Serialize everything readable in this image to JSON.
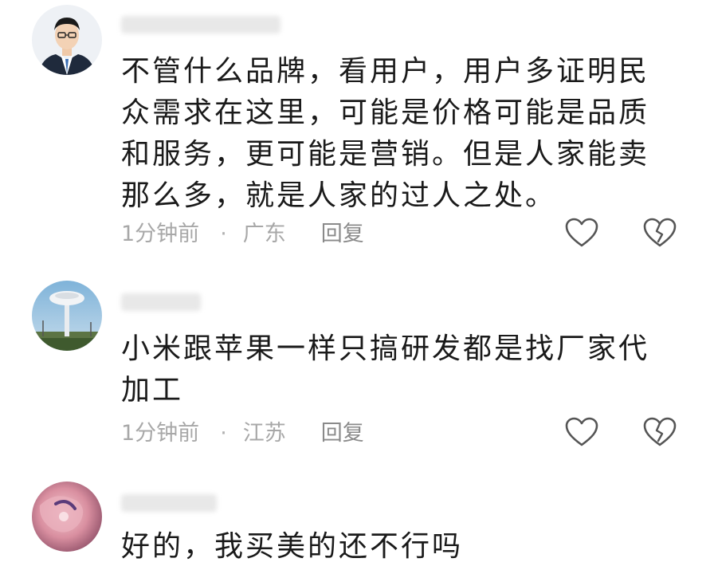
{
  "comments": [
    {
      "username": "",
      "avatar": "man-in-suit-avatar",
      "text": "不管什么品牌，看用户，用户多证明民众需求在这里，可能是价格可能是品质和服务，更可能是营销。但是人家能卖那么多，就是人家的过人之处。",
      "time": "1分钟前",
      "separator": "·",
      "location": "广东",
      "reply_label": "回复",
      "like_icon": "heart-icon",
      "dislike_icon": "broken-heart-icon"
    },
    {
      "username": "",
      "avatar": "water-tower-avatar",
      "text": "小米跟苹果一样只搞研发都是找厂家代加工",
      "time": "1分钟前",
      "separator": "·",
      "location": "江苏",
      "reply_label": "回复",
      "like_icon": "heart-icon",
      "dislike_icon": "broken-heart-icon"
    },
    {
      "username": "",
      "avatar": "pink-abstract-avatar",
      "text": "好的，我买美的还不行吗"
    }
  ]
}
